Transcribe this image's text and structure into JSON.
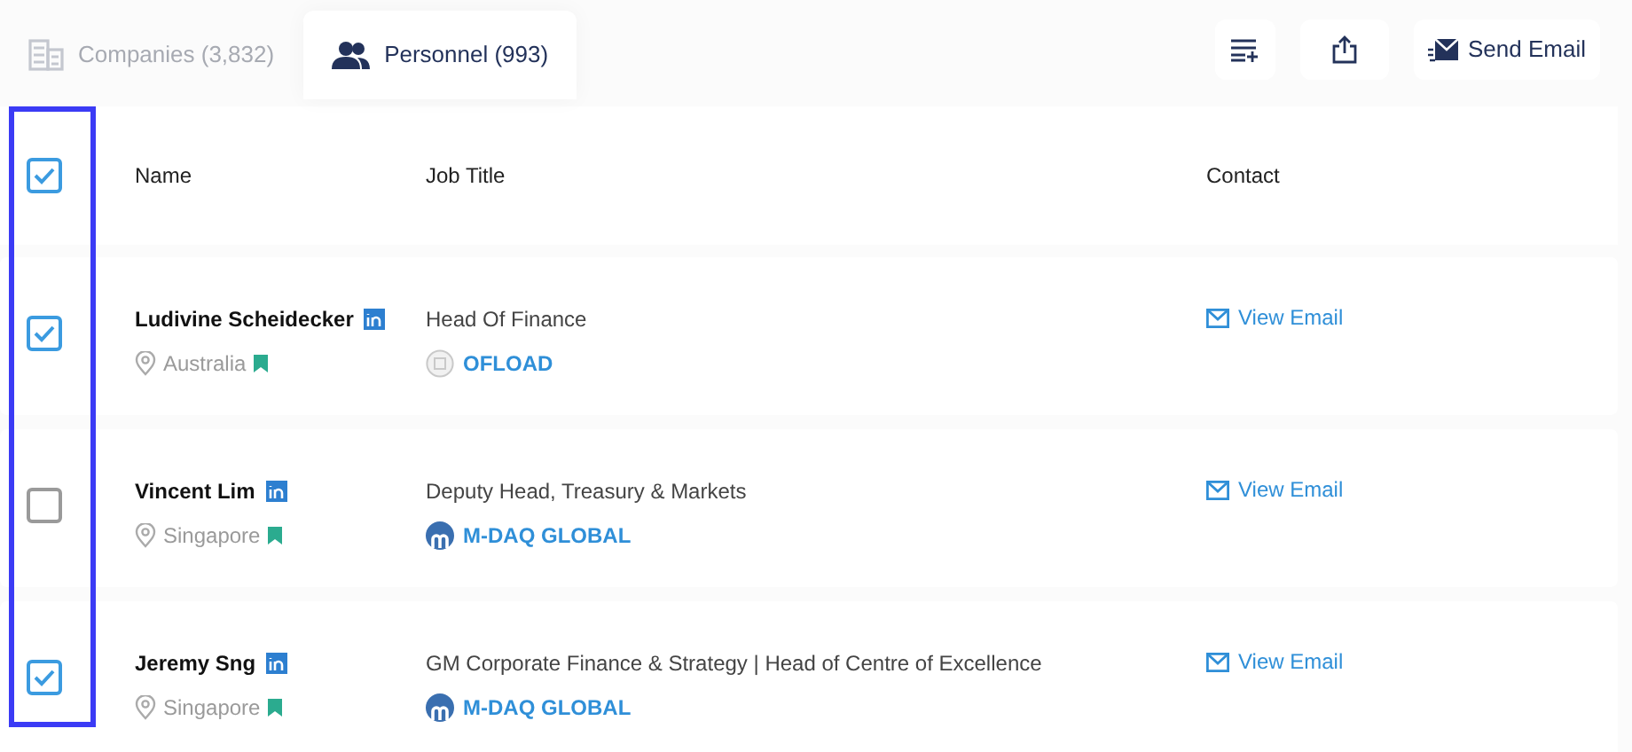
{
  "tabs": [
    {
      "label": "Companies (3,832)",
      "kind": "companies",
      "selected": false
    },
    {
      "label": "Personnel (993)",
      "kind": "personnel",
      "selected": true
    }
  ],
  "toolbar": {
    "send_email": "Send Email"
  },
  "table": {
    "select_all_checked": true,
    "columns": [
      "Name",
      "Job Title",
      "Contact"
    ],
    "rows": [
      {
        "checked": true,
        "name": "Ludivine Scheidecker",
        "location": "Australia",
        "job_title": "Head Of Finance",
        "company": "OFLOAD",
        "kind": "placeholder",
        "contact": "View Email"
      },
      {
        "checked": false,
        "name": "Vincent Lim",
        "location": "Singapore",
        "job_title": "Deputy Head, Treasury & Markets",
        "company": "M-DAQ GLOBAL",
        "kind": "logo",
        "contact": "View Email"
      },
      {
        "checked": true,
        "name": "Jeremy Sng",
        "location": "Singapore",
        "job_title": "GM Corporate Finance & Strategy | Head of Centre of Excellence",
        "company": "M-DAQ GLOBAL",
        "kind": "logo",
        "contact": "View Email"
      }
    ]
  }
}
